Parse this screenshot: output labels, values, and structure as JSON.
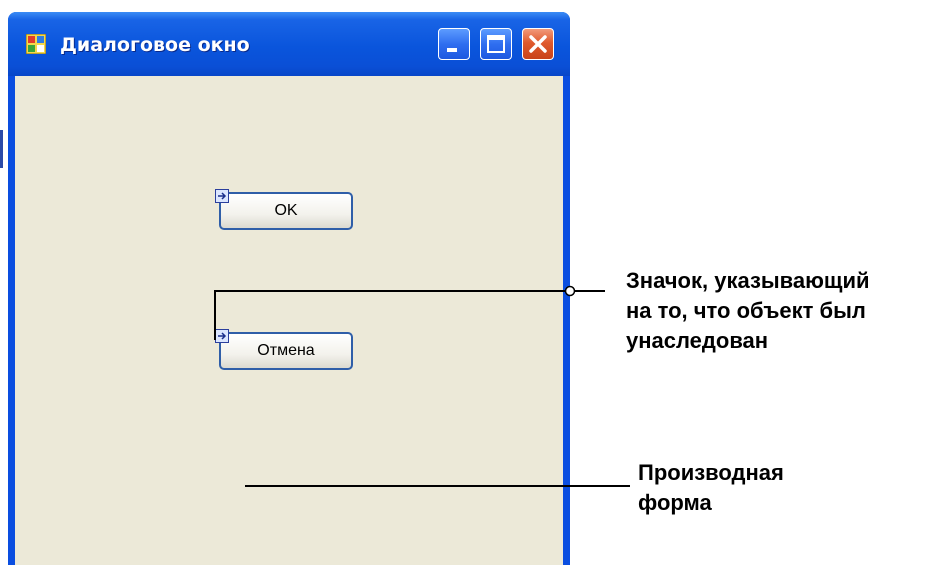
{
  "window": {
    "title": "Диалоговое окно",
    "title_bar_color": "#0a55dc",
    "client_color": "#ece9d8"
  },
  "buttons": {
    "ok_label": "OK",
    "cancel_label": "Отмена"
  },
  "icons": {
    "app": "app-window-icon",
    "minimize": "minimize-icon",
    "maximize": "maximize-icon",
    "close": "close-icon",
    "inherited": "inherited-object-icon"
  },
  "annotations": {
    "inherit_icon_note": "Значок, указывающий\nна то, что объект был\nунаследован",
    "derived_form_note": "Производная\nформа"
  }
}
